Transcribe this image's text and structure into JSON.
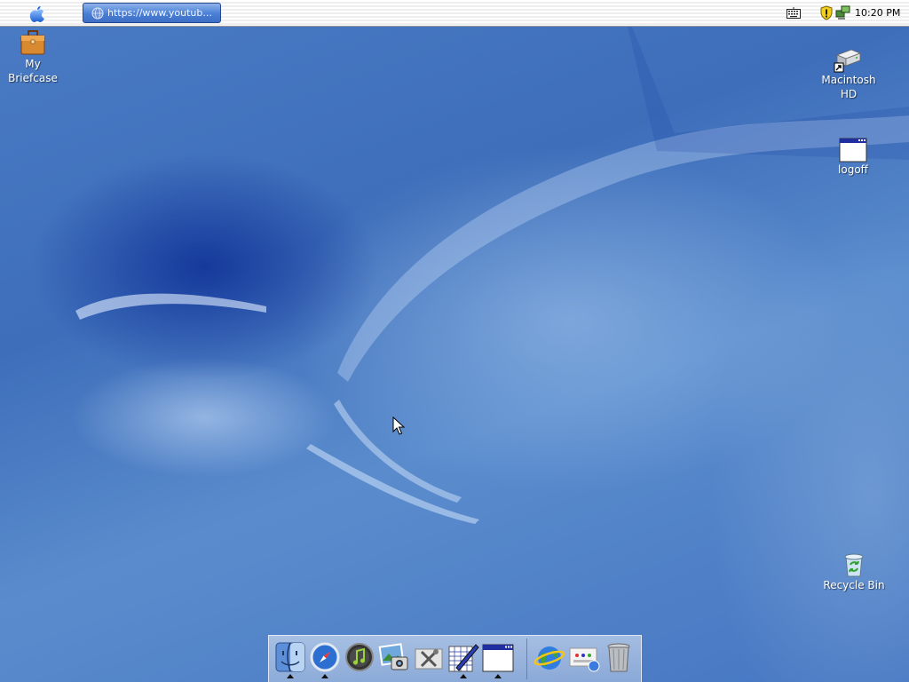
{
  "menubar": {
    "apple_menu_icon": "apple-icon",
    "address_tab_text": "https://www.youtub...",
    "address_tab_icon": "globe-icon",
    "tray": {
      "keyboard_icon": "keyboard-icon",
      "security_icon": "security-shield-icon",
      "network_icon": "network-connection-icon",
      "clock": "10:20 PM"
    }
  },
  "desktop": {
    "icons": [
      {
        "label_line1": "My",
        "label_line2": "Briefcase",
        "icon": "briefcase-icon"
      },
      {
        "label_line1": "Macintosh",
        "label_line2": "HD",
        "icon": "hard-drive-icon"
      },
      {
        "label_line1": "logoff",
        "label_line2": "",
        "icon": "application-window-icon"
      },
      {
        "label_line1": "Recycle Bin",
        "label_line2": "",
        "icon": "recycle-bin-icon"
      }
    ]
  },
  "dock": {
    "items": [
      {
        "icon": "finder-icon",
        "running": true
      },
      {
        "icon": "safari-compass-icon",
        "running": true
      },
      {
        "icon": "itunes-music-icon",
        "running": false
      },
      {
        "icon": "iphoto-icon",
        "running": false
      },
      {
        "icon": "system-tools-icon",
        "running": false
      },
      {
        "icon": "textedit-pen-icon",
        "running": true
      },
      {
        "icon": "application-window-icon",
        "running": true
      },
      {
        "icon": "internet-globe-icon",
        "running": false
      },
      {
        "icon": "network-settings-icon",
        "running": false
      },
      {
        "icon": "trash-icon",
        "running": false
      }
    ]
  },
  "colors": {
    "desktop_base": "#4a7bc4",
    "desktop_dark": "#0e3096",
    "address_tab": "#4a7fd6"
  }
}
